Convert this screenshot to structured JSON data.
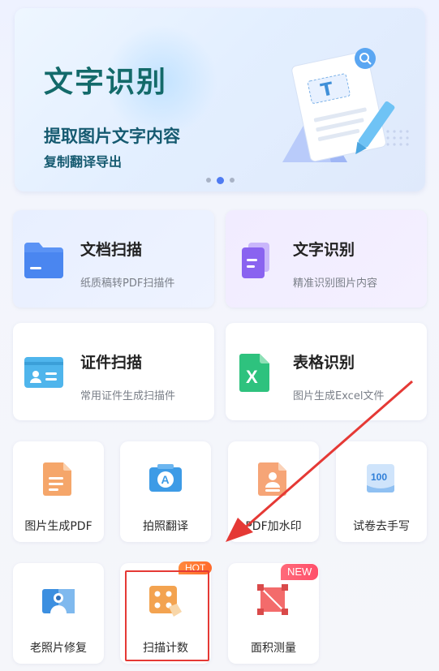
{
  "banner": {
    "title": "文字识别",
    "subtitle1": "提取图片文字内容",
    "subtitle2": "复制翻译导出",
    "carousel_pages": 3,
    "carousel_active": 2
  },
  "features": [
    {
      "title": "文档扫描",
      "subtitle": "纸质稿转PDF扫描件",
      "icon": "folder-icon"
    },
    {
      "title": "文字识别",
      "subtitle": "精准识别图片内容",
      "icon": "text-document-icon"
    },
    {
      "title": "证件扫描",
      "subtitle": "常用证件生成扫描件",
      "icon": "id-card-icon"
    },
    {
      "title": "表格识别",
      "subtitle": "图片生成Excel文件",
      "icon": "excel-icon"
    }
  ],
  "tools": [
    {
      "label": "图片生成PDF",
      "icon": "pdf-file-icon"
    },
    {
      "label": "拍照翻译",
      "icon": "camera-translate-icon"
    },
    {
      "label": "PDF加水印",
      "icon": "watermark-icon"
    },
    {
      "label": "试卷去手写",
      "icon": "exam-paper-icon"
    },
    {
      "label": "老照片修复",
      "icon": "photo-restore-icon"
    },
    {
      "label": "扫描计数",
      "icon": "scan-count-icon",
      "badge": "HOT"
    },
    {
      "label": "面积测量",
      "icon": "area-measure-icon",
      "badge": "NEW"
    }
  ],
  "colors": {
    "accent": "#4f7bf2",
    "highlight": "#e53935",
    "hot": "#ff7a33",
    "new": "#ff5a72"
  }
}
